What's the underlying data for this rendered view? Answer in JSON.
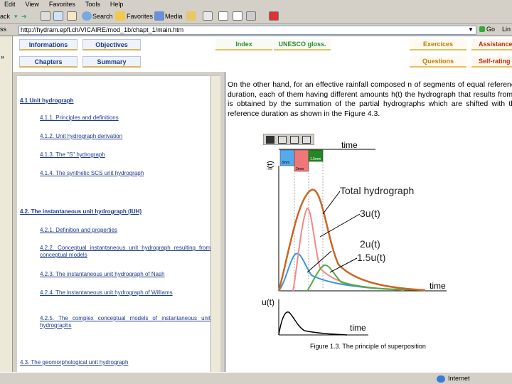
{
  "menu": [
    "Edit",
    "View",
    "Favorites",
    "Tools",
    "Help"
  ],
  "toolbar": {
    "back_label": "ack",
    "search_label": "Search",
    "favorites_label": "Favorites",
    "media_label": "Media"
  },
  "address": {
    "label": "ss",
    "url": "http://hydram.epfl.ch/VICAIRE/mod_1b/chapt_1/main.htm",
    "go_label": "Go",
    "links_label": "Lin"
  },
  "nav": {
    "informations": "Informations",
    "objectives": "Objectives",
    "chapters": "Chapters",
    "summary": "Summary",
    "index": "Index",
    "unesco": "UNESCO gloss.",
    "exercices": "Exercices",
    "questions": "Questions",
    "assistance": "Assistance",
    "self_rating": "Self-rating"
  },
  "toc": {
    "s41": "4.1 Unit hydrograph",
    "s411": "4.1.1. Principles and definitions",
    "s412": "4.1.2. Unit hydrograph derivation",
    "s413": "4.1.3. The \"S\" hydrograph",
    "s414": "4.1.4. The synthetic SCS unit hydrograph",
    "s42": "4.2. The instantaneous unit hydrograph (IUH)",
    "s421": "4.2.1. Definition and properties",
    "s422": "4.2.2. Conceptual instantaneous unit hydrograph resulting from conceptual models",
    "s423": "4.2.3. The instantaneous unit hydrograph of Nash",
    "s424": "4.2.4. The instantaneous unit hydrograph of Williams",
    "s425": "4.2.5. The complex conceptual models of instantaneous unit hydrographs",
    "s43": "4.3. The geomorphological unit hydrograph"
  },
  "main": {
    "paragraph": "On the other hand, for an effective rainfall composed n of segments of equal reference duration, each of them having different amounts h(t) the hydrograph that results from it is obtained by the summation of the partial hydrographs which are shifted with the reference duration as shown in the Figure 4.3.",
    "caption": "Figure 1.3. The principle of superposition"
  },
  "figure": {
    "axis_top_y": "i(t)",
    "axis_bottom_y": "u(t)",
    "time_top": "time",
    "time_mid": "time",
    "time_bottom": "time",
    "label_total": "Total hydrograph",
    "label_3u": "3u(t)",
    "label_2u": "2u(t)",
    "label_15u": "1.5u(t)",
    "bar1": "3mm",
    "bar2": "2mm",
    "bar3": "1.5mm",
    "colors": {
      "bar1": "#55aaee",
      "bar2": "#ee7777",
      "bar3": "#228822",
      "total": "#cc6622",
      "pink": "#f08a8a",
      "blue": "#3399dd",
      "green": "#55aa44"
    }
  },
  "status": {
    "zone": "Internet"
  }
}
